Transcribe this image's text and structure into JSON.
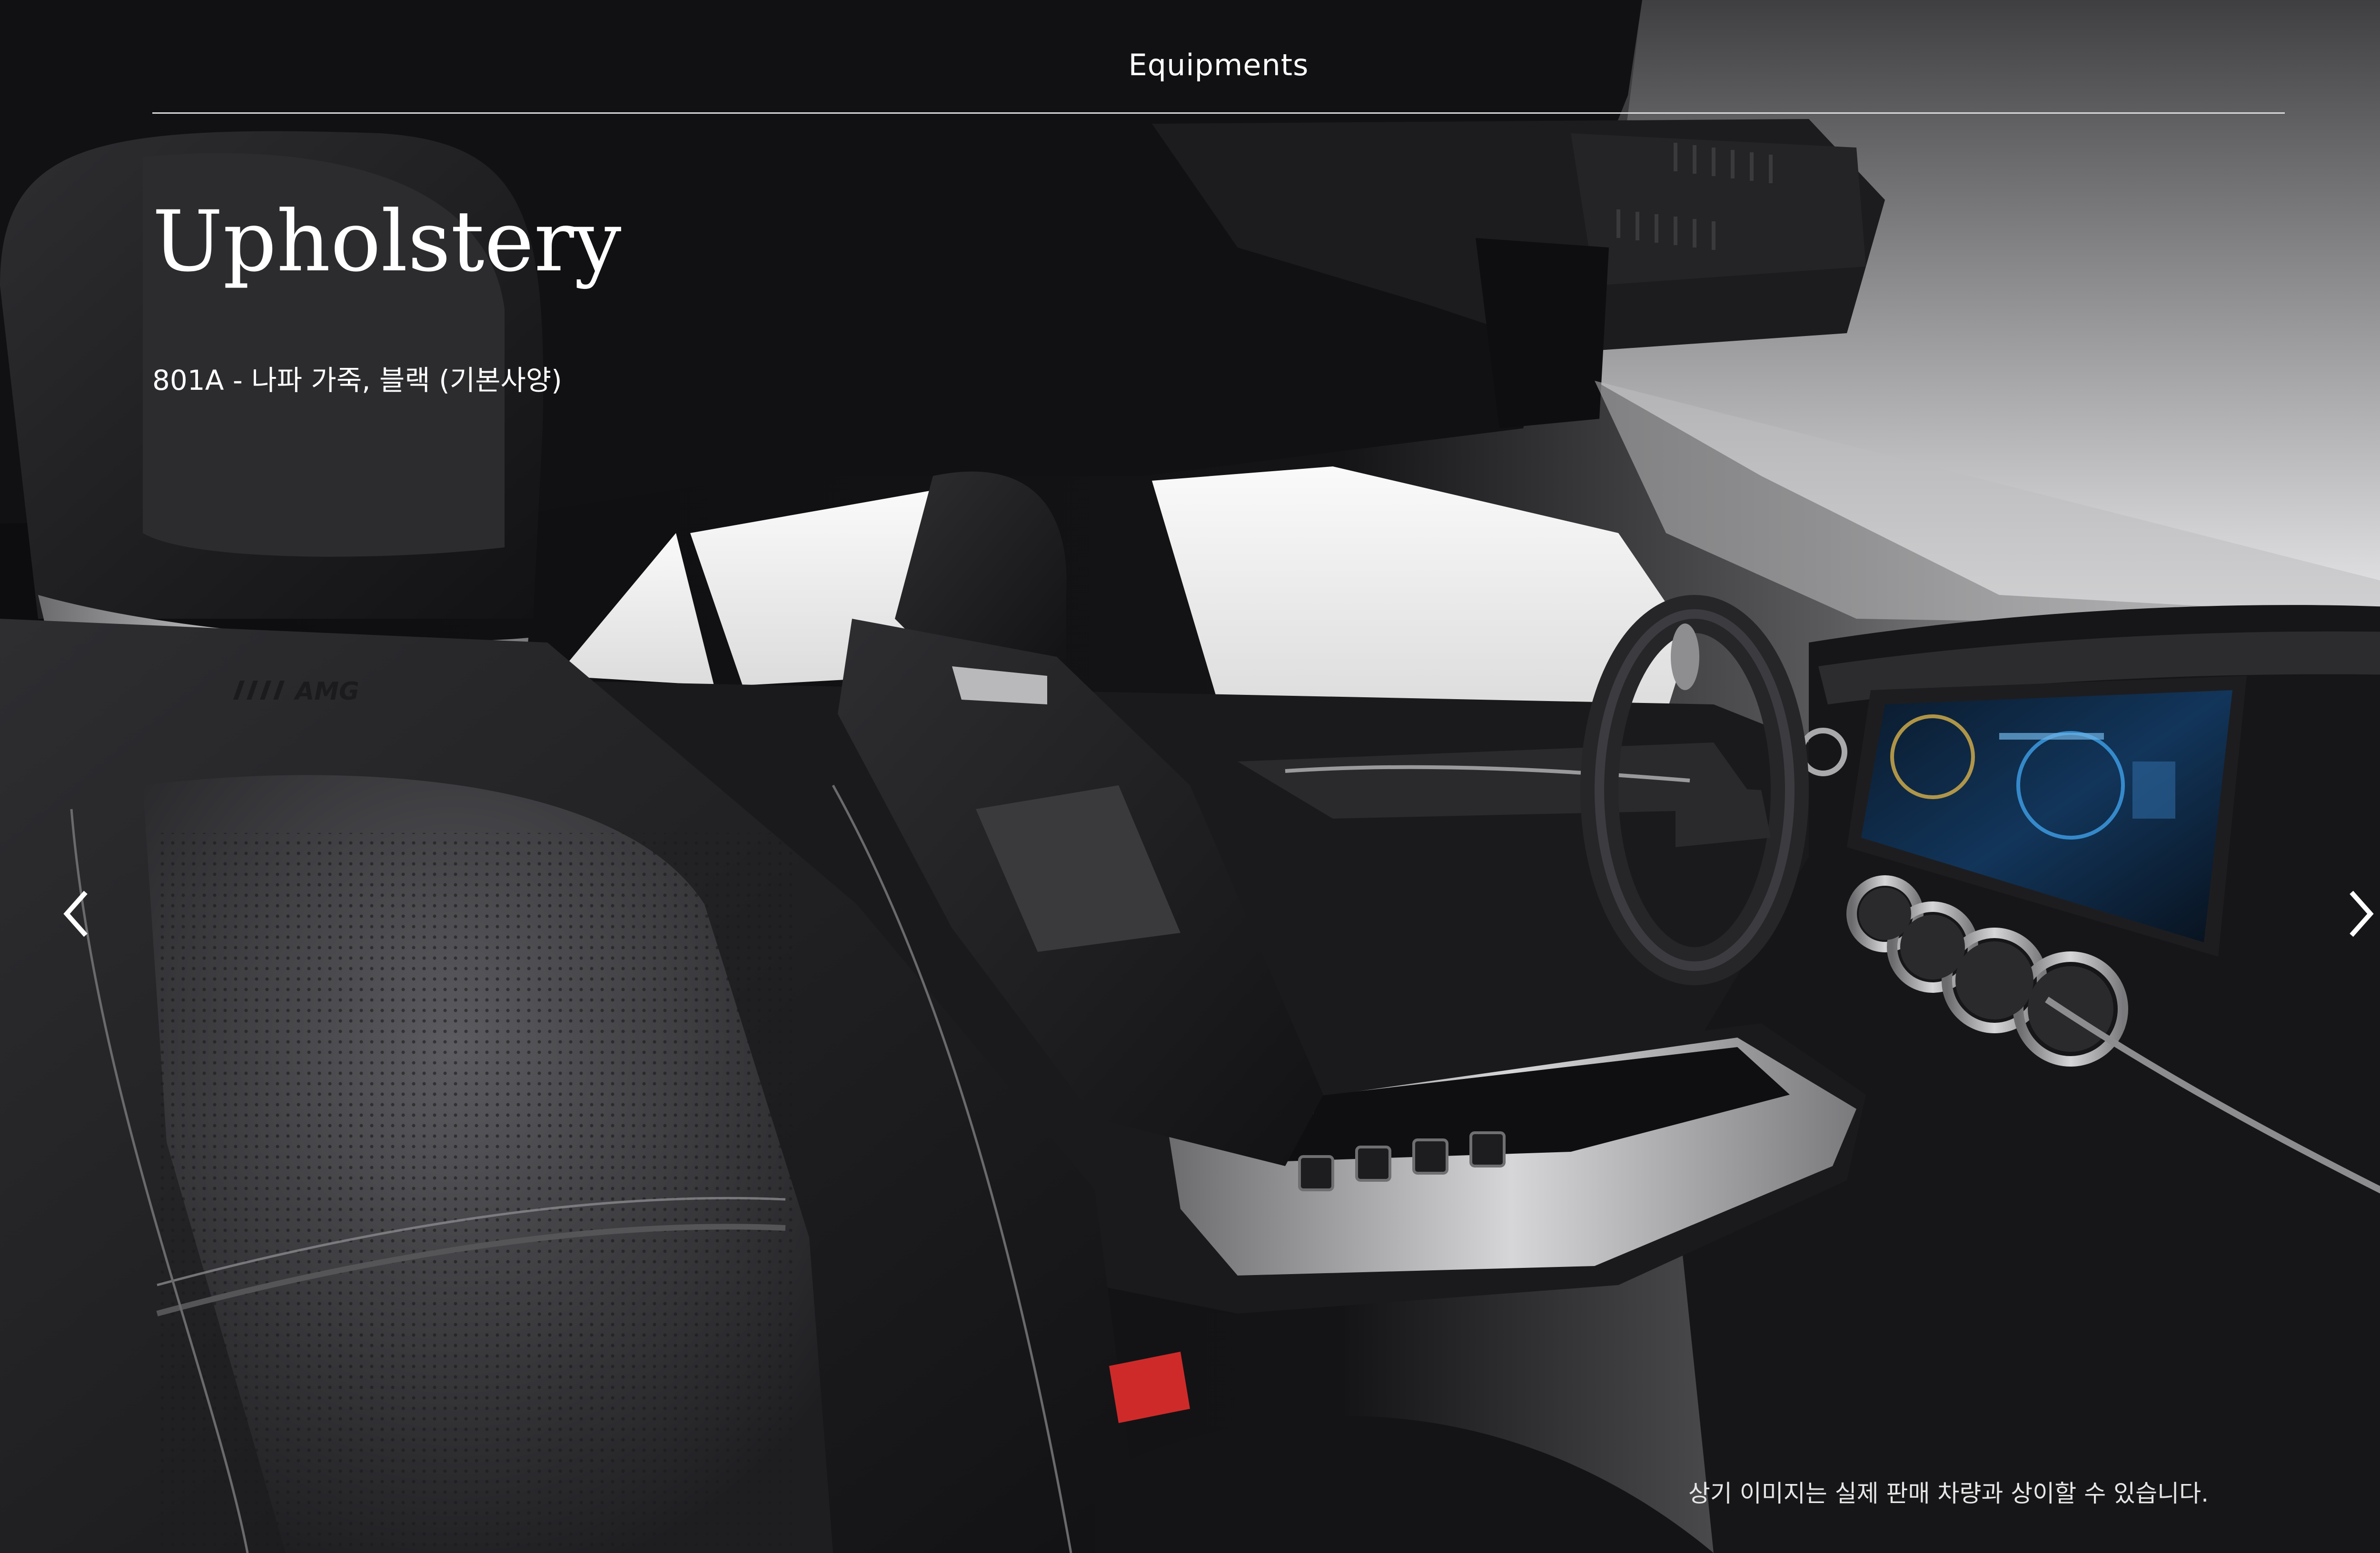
{
  "header": {
    "title": "Equipments"
  },
  "section": {
    "title": "Upholstery",
    "option": "801A - 나파 가죽, 블랙 (기본사양)"
  },
  "carousel": {
    "prev_icon": "chevron-left-icon",
    "next_icon": "chevron-right-icon"
  },
  "hero_image": {
    "badge": "AMG"
  },
  "footer": {
    "disclaimer": "상기 이미지는 실제 판매 차량과 상이할 수 있습니다."
  },
  "colors": {
    "text": "#ffffff",
    "rule": "#d8d8d8",
    "background": "#0c0c0e"
  }
}
